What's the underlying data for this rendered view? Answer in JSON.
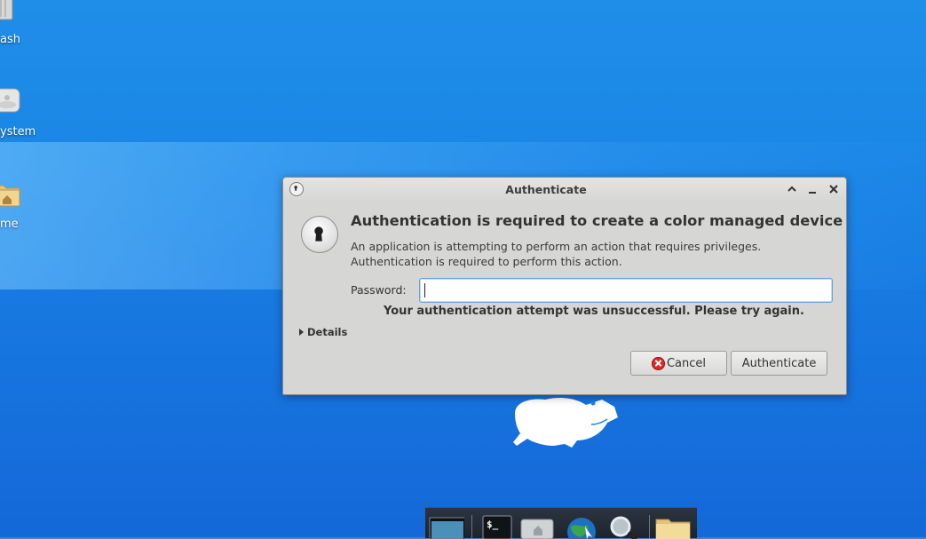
{
  "desktop": {
    "icons": [
      {
        "label": "ash",
        "icon": "trash-icon"
      },
      {
        "label": "ystem",
        "icon": "drive-icon"
      },
      {
        "label": "me",
        "icon": "home-folder-icon"
      }
    ]
  },
  "dialog": {
    "title": "Authenticate",
    "heading": "Authentication is required to create a color managed device",
    "body_line1": "An application is attempting to perform an action that requires privileges.",
    "body_line2": "Authentication is required to perform this action.",
    "password_label": "Password:",
    "password_value": "",
    "error_text": "Your authentication attempt was unsuccessful. Please try again.",
    "details_label": "Details",
    "cancel_label": "Cancel",
    "authenticate_label": "Authenticate"
  },
  "dock": {
    "items": [
      "show-desktop-icon",
      "terminal-icon",
      "file-manager-icon",
      "web-browser-icon",
      "search-icon",
      "folder-icon"
    ]
  },
  "colors": {
    "desktop_bg": "#1a86e6",
    "dialog_bg": "#d6d6d4",
    "focus_border": "#6aa0e0",
    "cancel_red": "#d62b2b"
  }
}
